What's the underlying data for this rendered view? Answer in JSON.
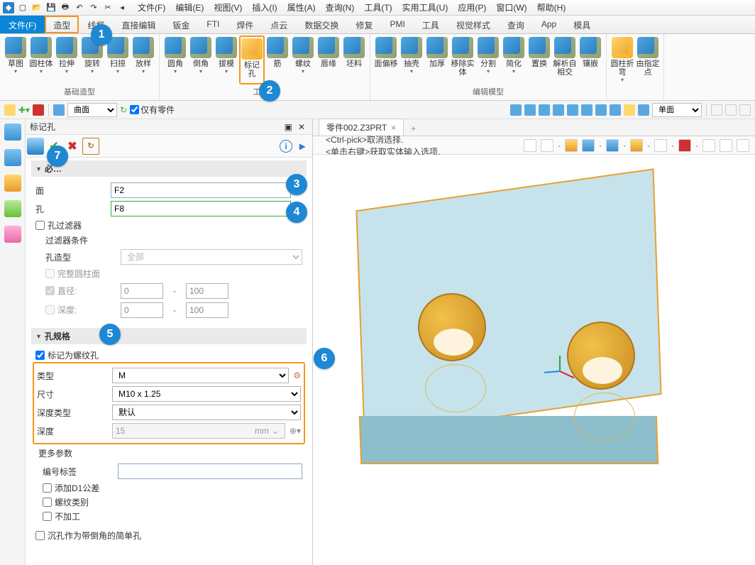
{
  "menu": {
    "qat": [
      "⎌",
      "▦",
      "▤",
      "💾",
      "🖶",
      "⎌",
      "↻",
      "⎘",
      "⎙",
      "▸"
    ],
    "items": [
      "文件(F)",
      "编辑(E)",
      "视图(V)",
      "插入(I)",
      "属性(A)",
      "查询(N)",
      "工具(T)",
      "实用工具(U)",
      "应用(P)",
      "窗口(W)",
      "帮助(H)"
    ]
  },
  "ribbonTabs": [
    "文件(F)",
    "造型",
    "线框",
    "直接编辑",
    "钣金",
    "FTI",
    "焊件",
    "点云",
    "数据交换",
    "修复",
    "PMI",
    "工具",
    "视觉样式",
    "查询",
    "App",
    "模具"
  ],
  "ribbon": {
    "group1": {
      "label": "基础造型",
      "buttons": [
        "草图",
        "圆柱体",
        "拉伸",
        "旋转",
        "扫掠",
        "放样"
      ]
    },
    "group2": {
      "label": "工程…",
      "buttons": [
        "圆角",
        "倒角",
        "拔模",
        "标记孔",
        "筋",
        "螺纹",
        "唇缘",
        "坯料"
      ]
    },
    "group3": {
      "label": "编辑模型",
      "buttons": [
        "面偏移",
        "抽壳",
        "加厚",
        "移除实体",
        "分割",
        "简化",
        "置换",
        "解析自相交",
        "镶嵌"
      ]
    },
    "group4": {
      "label": "",
      "buttons": [
        "圆柱折弯",
        "由指定点"
      ]
    }
  },
  "toolbar2": {
    "surface": "曲面",
    "onlypart": "仅有零件",
    "single": "单面"
  },
  "panel": {
    "title": "标记孔",
    "secRequired": "必…",
    "face": "面",
    "faceVal": "F2",
    "hole": "孔",
    "holeVal": "F8",
    "holeFilter": "孔过滤器",
    "filterCond": "过滤器条件",
    "holeType": "孔造型",
    "holeTypeVal": "全部",
    "fullCyl": "完整圆柱面",
    "diameter": "直径:",
    "diaMin": "0",
    "diaMax": "100",
    "depth": "深度:",
    "depMin": "0",
    "depMax": "100",
    "secSpec": "孔规格",
    "markThread": "标记为螺纹孔",
    "type": "类型",
    "typeVal": "M",
    "size": "尺寸",
    "sizeVal": "M10 x 1.25",
    "depthType": "深度类型",
    "depthTypeVal": "默认",
    "depthL": "深度",
    "depthVal": "15",
    "depthUnit": "mm",
    "moreParams": "更多参数",
    "numLabel": "编号标签",
    "addD1": "添加D1公差",
    "threadClass": "螺纹类别",
    "noMachine": "不加工",
    "csinkSimple": "沉孔作为带倒角的简单孔"
  },
  "viewport": {
    "tab": "零件002.Z3PRT",
    "hint1": "<Ctrl-pick>取消选择.",
    "hint2": "<单击右键>获取实体输入选项."
  },
  "callouts": {
    "1": "1",
    "2": "2",
    "3": "3",
    "4": "4",
    "5": "5",
    "6": "6",
    "7": "7"
  }
}
